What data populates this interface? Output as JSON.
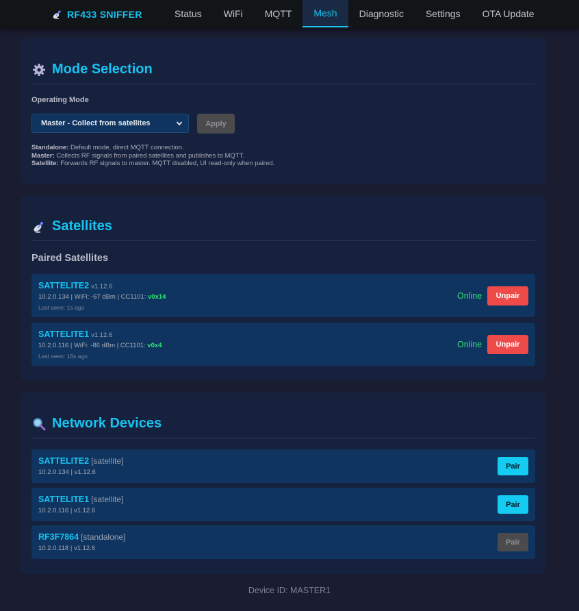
{
  "brand": {
    "title": "RF433 SNIFFER",
    "icon": "satellite-dish-icon"
  },
  "nav": {
    "tabs": [
      {
        "label": "Status"
      },
      {
        "label": "WiFi"
      },
      {
        "label": "MQTT"
      },
      {
        "label": "Mesh",
        "active": true
      },
      {
        "label": "Diagnostic"
      },
      {
        "label": "Settings"
      },
      {
        "label": "OTA Update"
      }
    ]
  },
  "mode": {
    "title": "Mode Selection",
    "icon": "gear-icon",
    "label": "Operating Mode",
    "selected": "Master - Collect from satellites",
    "apply_label": "Apply",
    "help": [
      {
        "term": "Standalone:",
        "text": " Default mode, direct MQTT connection."
      },
      {
        "term": "Master:",
        "text": " Collects RF signals from paired satellites and publishes to MQTT."
      },
      {
        "term": "Satellite:",
        "text": " Forwards RF signals to master. MQTT disabled, UI read-only when paired."
      }
    ]
  },
  "satellites": {
    "title": "Satellites",
    "icon": "satellite-dish-icon",
    "subheading": "Paired Satellites",
    "items": [
      {
        "name": "SATTELITE2",
        "version": "v1.12.6",
        "meta": "10.2.0.134 | WiFi: -67 dBm | CC1101: ",
        "chip": "v0x14",
        "seen": "Last seen: 1s ago",
        "status": "Online",
        "action": "Unpair"
      },
      {
        "name": "SATTELITE1",
        "version": "v1.12.6",
        "meta": "10.2.0.116 | WiFi: -86 dBm | CC1101: ",
        "chip": "v0x4",
        "seen": "Last seen: 16s ago",
        "status": "Online",
        "action": "Unpair"
      }
    ]
  },
  "network": {
    "title": "Network Devices",
    "icon": "magnifier-icon",
    "items": [
      {
        "name": "SATTELITE2",
        "kind": "[satellite]",
        "meta": "10.2.0.134 | v1.12.6",
        "action": "Pair",
        "enabled": true
      },
      {
        "name": "SATTELITE1",
        "kind": "[satellite]",
        "meta": "10.2.0.116 | v1.12.6",
        "action": "Pair",
        "enabled": true
      },
      {
        "name": "RF3F7864",
        "kind": "[standalone]",
        "meta": "10.2.0.118 | v1.12.6",
        "action": "Pair",
        "enabled": false
      }
    ]
  },
  "footer": {
    "device_id": "Device ID: MASTER1"
  },
  "colors": {
    "accent": "#19c3f0",
    "online": "#2ee66f",
    "danger": "#ef4a4a",
    "card": "#16213e",
    "row": "#0f3460"
  }
}
